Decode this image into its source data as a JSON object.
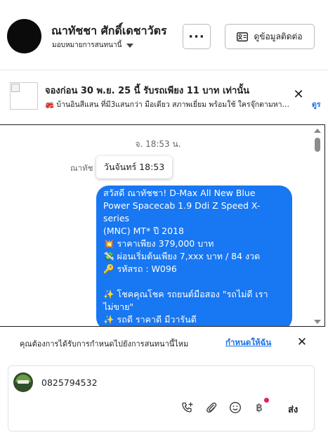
{
  "header": {
    "name": "ณาทัชชา ศักดิ์เดชาวัตร",
    "assign_label": "มอบหมายการสนทนานี้",
    "more_label": "···",
    "contact_label": "ดูข้อมูลติดต่อ"
  },
  "ad": {
    "title": "จองก่อน 30 พ.ย. 25 นี้ รับรถเพียง 11 บาท เท่านั้น",
    "description": "🚒 บ้านอินสีแสน ที่มี3แสนกว่า มือเดียว สภาพเยี่ยม พร้อมใช้ ใครจุ๊กตามหา…",
    "link_label": "ดูร"
  },
  "conversation": {
    "timestamp": "จ. 18:53 น.",
    "system_message": "ณาทัช                         อบกลับโฆษณา",
    "tooltip": "วันจันทร์ 18:53",
    "bubble_lines": [
      "สวัสดี ณาทัชชา! D-Max All New Blue",
      "Power Spacecab 1.9 Ddi Z Speed X-series",
      "(MNC) MT* ปี 2018",
      "💥 ราคาเพียง 379,000 บาท",
      "💸 ผ่อนเริ่มต้นเพียง 7,xxx บาท / 84 งวด",
      "🔑 รหัสรถ : W096",
      "",
      "✨ โชคคุณโชค รถยนต์มือสอง \"รถไม่ดี เรา",
      "ไม่ขาย\"",
      "✨ รถดี ราคาดี มีวารันตี"
    ]
  },
  "prompt": {
    "text": "คุณต้องการได้รับการกำหนดไปยังการสนทนานี้ไหม",
    "link_label": "กำหนดให้ฉัน"
  },
  "composer": {
    "input_value": "0825794532",
    "send_label": "ส่ง",
    "tools": [
      "phone-plus-icon",
      "paperclip-icon",
      "emoji-icon",
      "baht-icon"
    ]
  },
  "colors": {
    "bubble": "#1877f2",
    "link": "#1a73e8",
    "notification_dot": "#e0245e"
  }
}
